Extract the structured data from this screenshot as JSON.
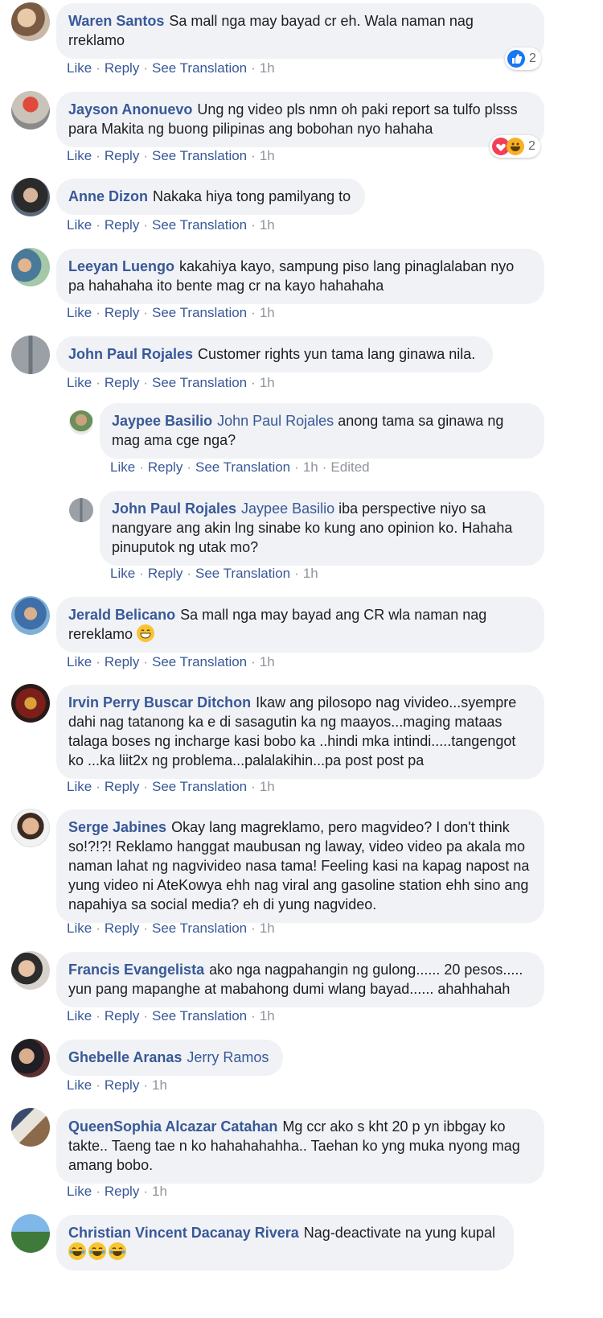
{
  "actions": {
    "like": "Like",
    "reply": "Reply",
    "see_translation": "See Translation"
  },
  "comments": [
    {
      "author": "Waren Santos",
      "text": "Sa mall nga may bayad cr eh. Wala naman nag rreklamo",
      "time": "1h",
      "reactions": {
        "count": "2",
        "types": [
          "like"
        ]
      }
    },
    {
      "author": "Jayson Anonuevo",
      "text": "Ung ng video pls nmn oh paki report sa tulfo plsss para Makita ng buong pilipinas ang bobohan nyo hahaha",
      "time": "1h",
      "reactions": {
        "count": "2",
        "types": [
          "love",
          "haha"
        ]
      }
    },
    {
      "author": "Anne Dizon",
      "text": "Nakaka hiya tong pamilyang to",
      "time": "1h"
    },
    {
      "author": "Leeyan Luengo",
      "text": "kakahiya kayo, sampung piso lang pinaglalaban nyo pa hahahaha ito bente mag cr na kayo hahahaha",
      "time": "1h"
    },
    {
      "author": "John Paul Rojales",
      "text": "Customer rights yun tama lang ginawa nila.",
      "time": "1h"
    },
    {
      "author": "Jaypee Basilio",
      "mention": "John Paul Rojales",
      "text": "anong tama sa ginawa ng mag ama cge nga?",
      "time": "1h",
      "edited": "Edited"
    },
    {
      "author": "John Paul Rojales",
      "mention": "Jaypee Basilio",
      "text": "iba perspective niyo sa nangyare ang akin lng sinabe ko kung ano opinion ko. Hahaha pinuputok ng utak mo?",
      "time": "1h"
    },
    {
      "author": "Jerald Belicano",
      "text": "Sa mall nga may bayad ang CR wla naman nag rereklamo",
      "emoji": "grin-emoji",
      "time": "1h"
    },
    {
      "author": "Irvin Perry Buscar Ditchon",
      "text": "Ikaw ang pilosopo nag vivideo...syempre dahi nag tatanong ka e di sasagutin ka ng maayos...maging mataas talaga boses ng incharge kasi bobo ka ..hindi mka intindi.....tangengot ko ...ka liit2x ng problema...palalakihin...pa post post pa",
      "time": "1h"
    },
    {
      "author": "Serge Jabines",
      "text": "Okay lang magreklamo, pero magvideo? I don't think so!?!?! Reklamo hanggat maubusan ng laway, video video pa akala mo naman lahat ng nagvivideo nasa tama! Feeling kasi na kapag napost na yung video ni AteKowya ehh nag viral ang gasoline station ehh sino ang napahiya sa social media? eh di yung nagvideo.",
      "time": "1h"
    },
    {
      "author": "Francis Evangelista",
      "text": "ako nga nagpahangin ng gulong...... 20 pesos..... yun pang mapanghe at mabahong dumi wlang bayad...... ahahhahah",
      "time": "1h"
    },
    {
      "author": "Ghebelle Aranas",
      "mention": "Jerry Ramos",
      "text": "",
      "time": "1h"
    },
    {
      "author": "QueenSophia Alcazar Catahan",
      "text": "Mg ccr ako s kht 20 p yn ibbgay ko takte.. Taeng tae n ko hahahahahha.. Taehan ko yng muka nyong mag amang bobo.",
      "time": "1h"
    },
    {
      "author": "Christian Vincent Dacanay Rivera",
      "text": "Nag-deactivate na yung kupal",
      "emoji": "joy-emoji",
      "time": ""
    }
  ],
  "colors": {
    "name": "#385898",
    "bubble": "#f0f2f5",
    "meta": "#90949c",
    "like": "#1877f2",
    "love": "#f33e58",
    "haha": "#f7b125"
  }
}
